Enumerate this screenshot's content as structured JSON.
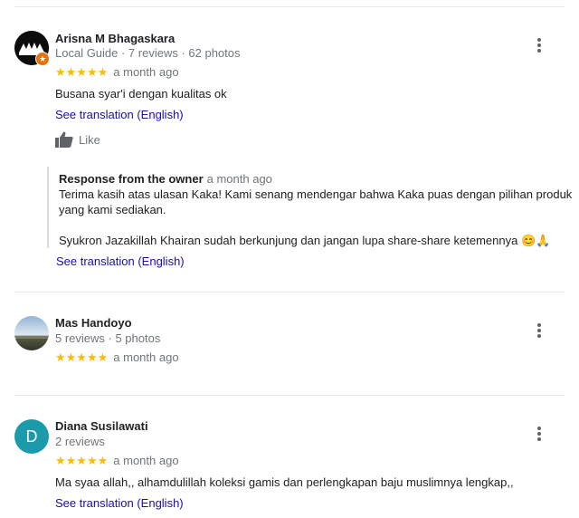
{
  "reviews": [
    {
      "name": "Arisna M Bhagaskara",
      "meta": "Local Guide · 7 reviews · 62 photos",
      "stars": "★★★★★",
      "date": "a month ago",
      "text": "Busana syar'i dengan kualitas ok",
      "translation_link": "See translation (English)",
      "like_label": "Like",
      "owner_response": {
        "title": "Response from the owner",
        "date": "a month ago",
        "line1": "Terima kasih atas ulasan Kaka! Kami senang mendengar bahwa Kaka puas dengan pilihan produk",
        "line2": "yang kami sediakan.",
        "line3": "Syukron Jazakillah Khairan sudah berkunjung dan jangan lupa share-share ketemennya 😊🙏",
        "translation_link": "See translation (English)"
      }
    },
    {
      "name": "Mas Handoyo",
      "meta": "5 reviews · 5 photos",
      "stars": "★★★★★",
      "date": "a month ago"
    },
    {
      "name": "Diana Susilawati",
      "meta": "2 reviews",
      "avatar_letter": "D",
      "stars": "★★★★★",
      "date": "a month ago",
      "text": "Ma syaa allah,, alhamdulillah koleksi gamis dan perlengkapan baju muslimnya lengkap,,",
      "translation_link": "See translation (English)"
    }
  ],
  "colors": {
    "star": "#fbbc04",
    "link": "#1a0dab",
    "avatar_d": "#1b9aaa",
    "guide_badge": "#e8710a"
  }
}
